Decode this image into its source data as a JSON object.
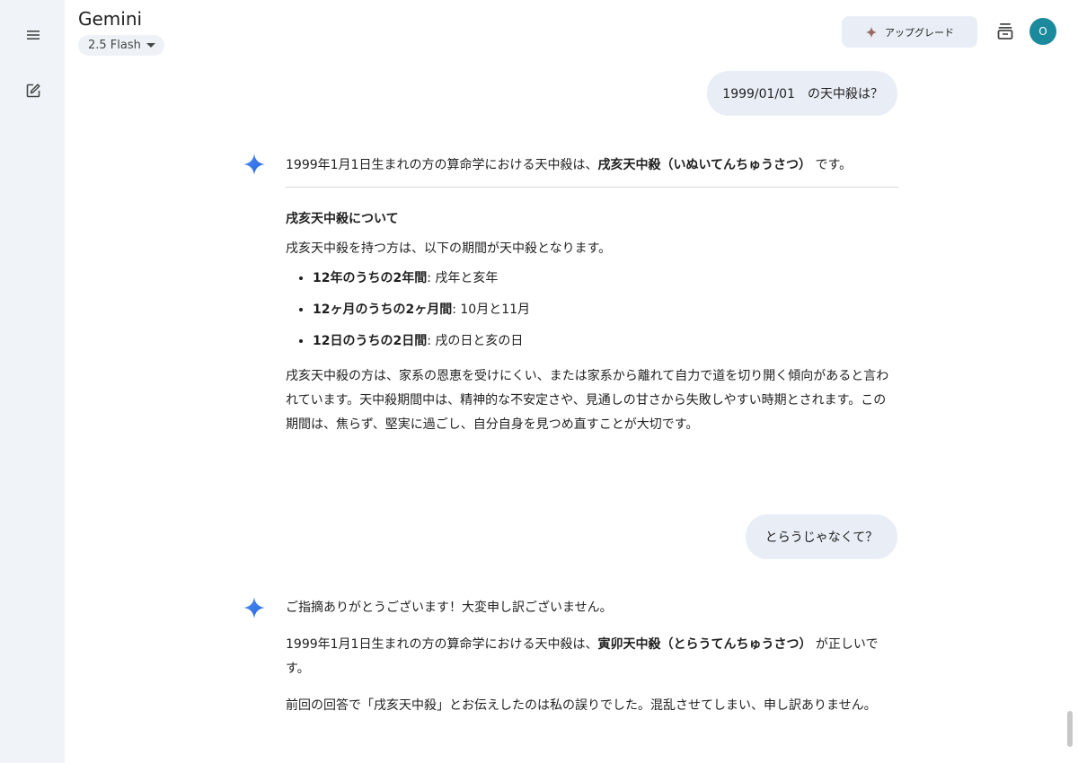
{
  "app": {
    "title": "Gemini",
    "model": "2.5 Flash"
  },
  "header": {
    "upgrade_label": "アップグレード",
    "avatar_initial": "O"
  },
  "conversation": {
    "q1": "1999/01/01　の天中殺は？",
    "a1": {
      "intro_pre": "1999年1月1日生まれの方の算命学における天中殺は、",
      "intro_bold": "戌亥天中殺（いぬいてんちゅうさつ）",
      "intro_post": "です。",
      "heading": "戌亥天中殺について",
      "lead": "戌亥天中殺を持つ方は、以下の期間が天中殺となります。",
      "bullets": [
        {
          "bold": "12年のうちの2年間",
          "text": ": 戌年と亥年"
        },
        {
          "bold": "12ヶ月のうちの2ヶ月間",
          "text": ": 10月と11月"
        },
        {
          "bold": "12日のうちの2日間",
          "text": ": 戌の日と亥の日"
        }
      ],
      "paragraph": "戌亥天中殺の方は、家系の恩恵を受けにくい、または家系から離れて自力で道を切り開く傾向があると言われています。天中殺期間中は、精神的な不安定さや、見通しの甘さから失敗しやすい時期とされます。この期間は、焦らず、堅実に過ごし、自分自身を見つめ直すことが大切です。"
    },
    "q2": "とらうじゃなくて？",
    "a2": {
      "line1": "ご指摘ありがとうございます！大変申し訳ございません。",
      "line2_pre": "1999年1月1日生まれの方の算命学における天中殺は、",
      "line2_bold": "寅卯天中殺（とらうてんちゅうさつ）",
      "line2_post": "が正しいです。",
      "line3": "前回の回答で「戌亥天中殺」とお伝えしたのは私の誤りでした。混乱させてしまい、申し訳ありません。"
    }
  },
  "icons": {
    "menu": "menu-icon",
    "new_chat": "edit-icon",
    "spark": "gemini-spark-icon",
    "history": "history-icon"
  },
  "colors": {
    "rail": "#f0f4f9",
    "bubble": "#e9eef6",
    "avatar": "#1b8a9c"
  }
}
